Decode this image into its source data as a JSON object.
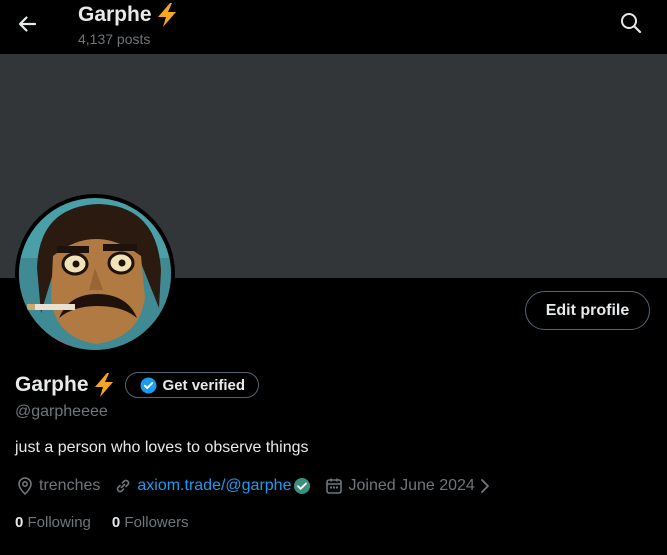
{
  "header": {
    "title": "Garphe",
    "posts_count": "4,137 posts"
  },
  "profile": {
    "name": "Garphe",
    "handle": "@garpheeee",
    "bio": "just a person who loves to observe things",
    "edit_label": "Edit profile",
    "verify_label": "Get verified",
    "location": "trenches",
    "website": "axiom.trade/@garphe",
    "joined": "Joined June 2024",
    "following_count": "0",
    "following_label": "Following",
    "followers_count": "0",
    "followers_label": "Followers"
  },
  "icons": {
    "back": "back-arrow-icon",
    "search": "search-icon",
    "bolt": "lightning-bolt-icon",
    "verified": "verified-badge-icon",
    "location": "location-pin-icon",
    "link": "link-icon",
    "calendar": "calendar-icon",
    "chevron": "chevron-right-icon"
  },
  "colors": {
    "background": "#000000",
    "banner": "#333639",
    "text_primary": "#e7e9ea",
    "text_secondary": "#71767b",
    "link": "#1d9bf0",
    "bolt": "#f4a622",
    "website_check": "#3e8e7e"
  }
}
